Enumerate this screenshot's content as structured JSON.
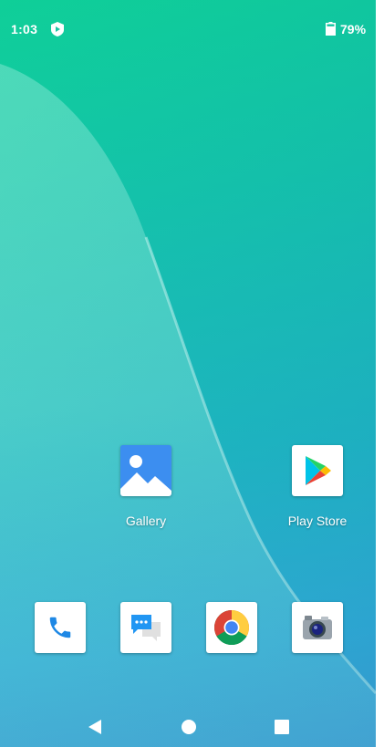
{
  "status_bar": {
    "time": "1:03",
    "battery_percent": "79%",
    "battery_level": 0.79
  },
  "home_apps": [
    {
      "label": "Gallery",
      "icon": "gallery-icon"
    },
    {
      "label": "Play Store",
      "icon": "play-store-icon"
    }
  ],
  "dock": [
    {
      "icon": "phone-icon"
    },
    {
      "icon": "messages-icon"
    },
    {
      "icon": "chrome-icon"
    },
    {
      "icon": "camera-icon"
    }
  ],
  "nav": {
    "back": "back-icon",
    "home": "home-icon",
    "recents": "recents-icon"
  },
  "colors": {
    "wallpaper_top": "#0fcf98",
    "wallpaper_bottom": "#3f9fd2",
    "phone_blue": "#1e88e5",
    "messages_blue": "#2196f3"
  }
}
